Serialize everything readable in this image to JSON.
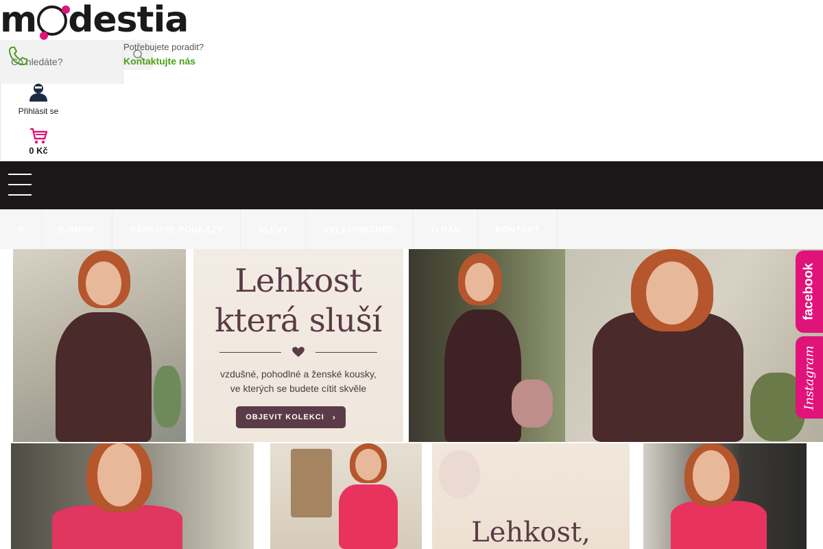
{
  "header": {
    "logo_text_before": "m",
    "logo_text_after": "destia",
    "search_placeholder": "Co hledáte?",
    "help_label": "Potřebujete poradit?",
    "help_link": "Kontaktujte nás",
    "login_label": "Přihlásit se",
    "cart_total": "0 Kč"
  },
  "nav": {
    "items": [
      "E-SHOP",
      "DÁRKOVÉ POUKAZY",
      "SLEVY",
      "VELKOOBCHOD",
      "O NÁS",
      "KONTAKT"
    ]
  },
  "banner": {
    "promo_title_line1": "Lehkost",
    "promo_title_line2": "která sluší",
    "promo_sub_line1": "vzdušné, pohodlné a ženské kousky,",
    "promo_sub_line2": "ve kterých se budete cítit skvěle",
    "promo_button": "OBJEVIT KOLEKCI",
    "promo2_title": "Lehkost,"
  },
  "social": {
    "facebook": "facebook",
    "instagram": "Instagram"
  },
  "colors": {
    "brand_pink": "#e0137a",
    "brand_green": "#4aa016",
    "promo_plum": "#5b3b47",
    "topbar_black": "#1a1718"
  },
  "icons": {
    "search": "search-icon",
    "phone": "phone-icon",
    "user": "user-icon",
    "cart": "cart-icon",
    "menu": "hamburger-icon",
    "home": "home-icon",
    "heart": "heart-icon"
  }
}
